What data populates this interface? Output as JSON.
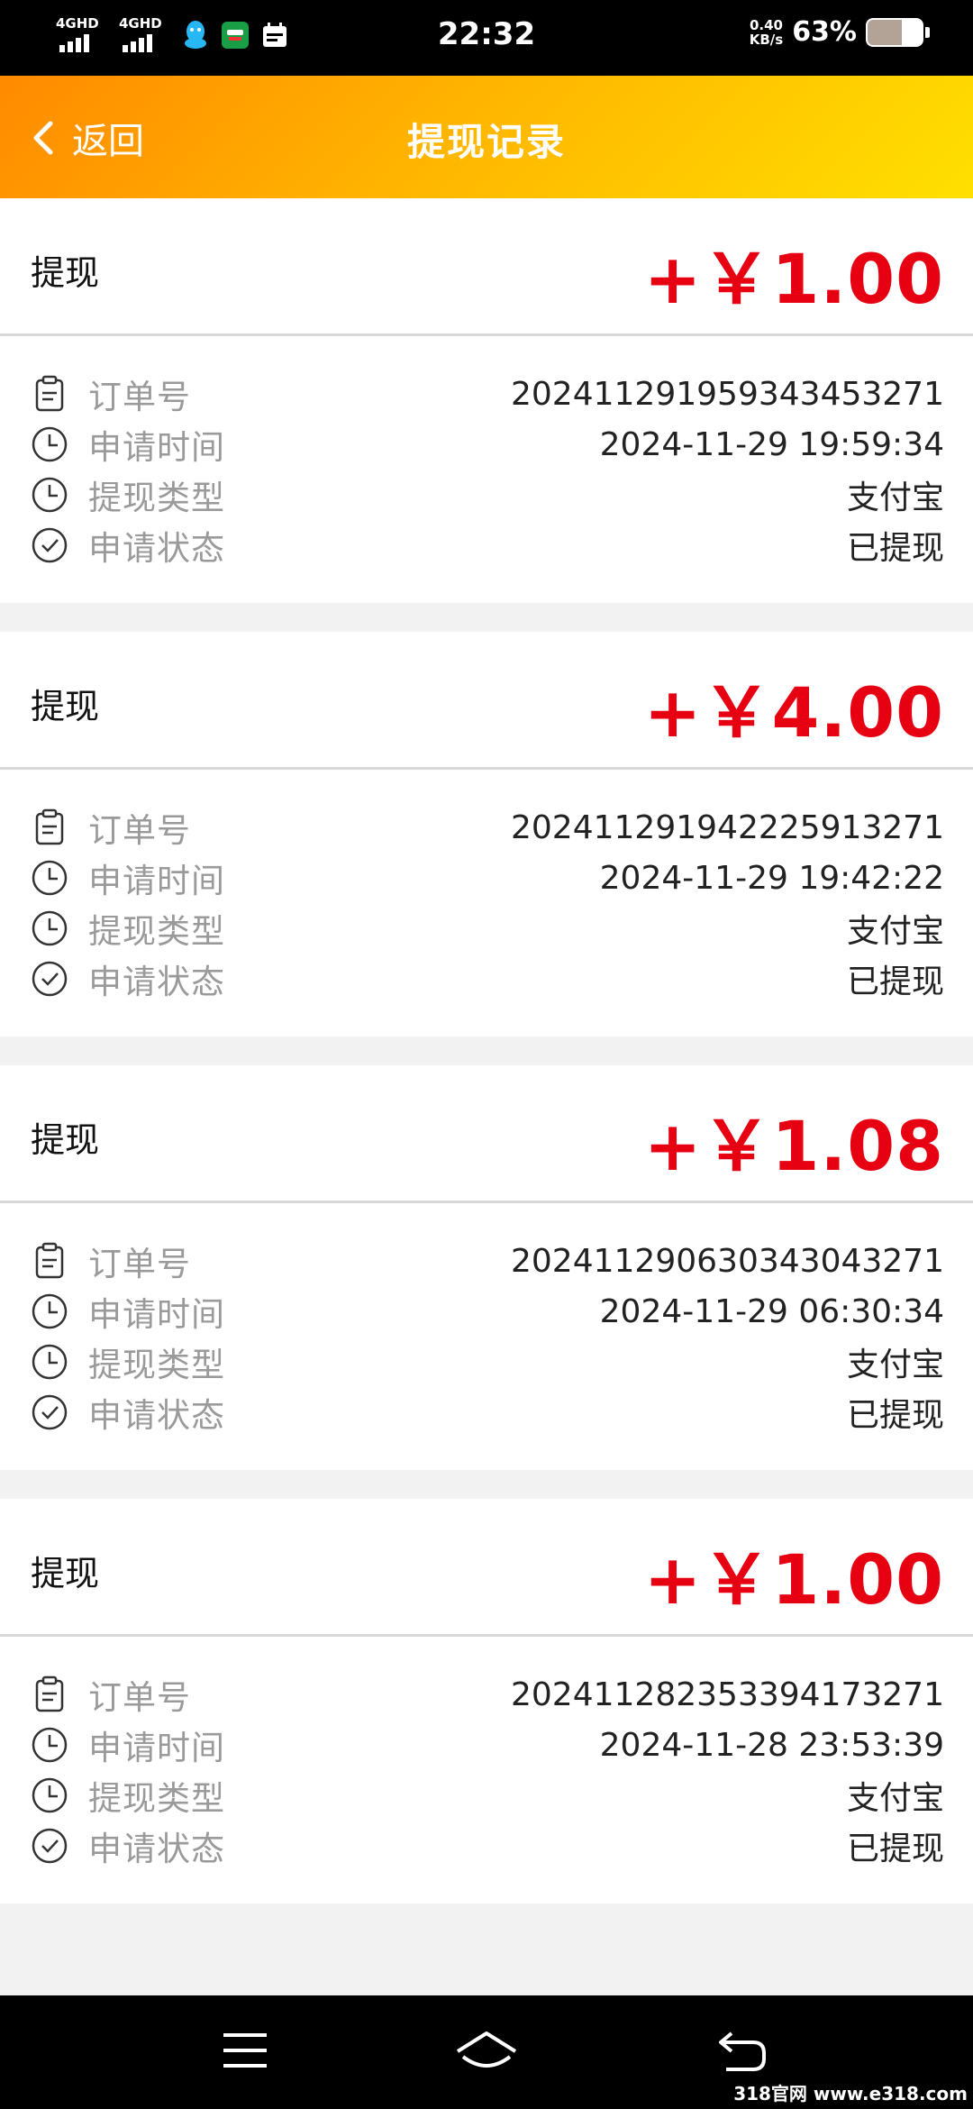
{
  "status_bar": {
    "network1": "4GHD",
    "network2": "4GHD",
    "time": "22:32",
    "speed_value": "0.40",
    "speed_unit": "KB/s",
    "battery": "63%",
    "battery_level": 0.63
  },
  "header": {
    "back_label": "返回",
    "title": "提现记录"
  },
  "field_labels": {
    "order_no": "订单号",
    "apply_time": "申请时间",
    "withdraw_type": "提现类型",
    "apply_status": "申请状态"
  },
  "records": [
    {
      "type": "提现",
      "amount": "+￥1.00",
      "order_no": "202411291959343453271",
      "apply_time": "2024-11-29 19:59:34",
      "withdraw_type": "支付宝",
      "apply_status": "已提现"
    },
    {
      "type": "提现",
      "amount": "+￥4.00",
      "order_no": "202411291942225913271",
      "apply_time": "2024-11-29 19:42:22",
      "withdraw_type": "支付宝",
      "apply_status": "已提现"
    },
    {
      "type": "提现",
      "amount": "+￥1.08",
      "order_no": "202411290630343043271",
      "apply_time": "2024-11-29 06:30:34",
      "withdraw_type": "支付宝",
      "apply_status": "已提现"
    },
    {
      "type": "提现",
      "amount": "+￥1.00",
      "order_no": "202411282353394173271",
      "apply_time": "2024-11-28 23:53:39",
      "withdraw_type": "支付宝",
      "apply_status": "已提现"
    }
  ],
  "watermark": "318官网 www.e318.com",
  "colors": {
    "accent_red": "#e60012",
    "header_start": "#ff8a00",
    "header_end": "#ffe000"
  }
}
